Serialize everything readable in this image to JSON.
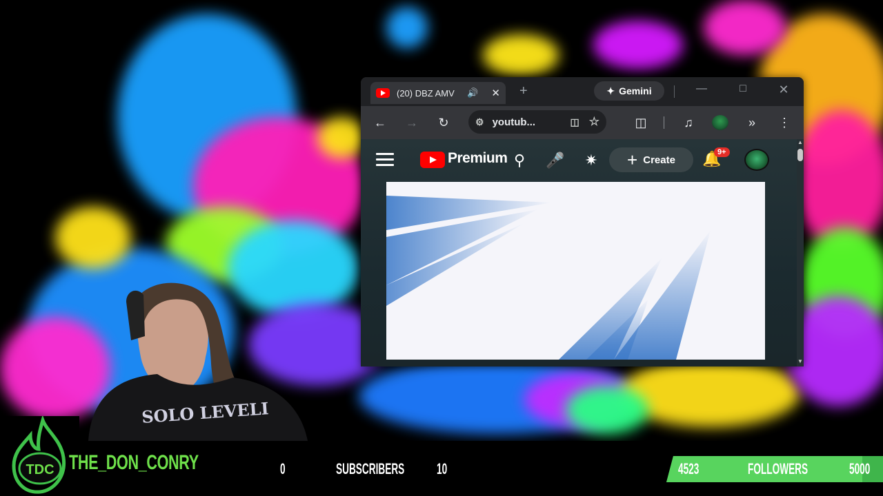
{
  "browser": {
    "tab_title": "(20) DBZ AMV",
    "gemini_label": "Gemini",
    "address": "youtub...",
    "colors": {
      "titlebar": "#202124",
      "toolbar": "#35363a"
    }
  },
  "youtube": {
    "brand_label": "Premium",
    "create_label": "Create",
    "notification_count": "9+"
  },
  "stream_overlay": {
    "channel_name": "THE_DON_CONRY",
    "subscribers": {
      "current": "0",
      "label": "SUBSCRIBERS",
      "goal": "10"
    },
    "followers": {
      "current": "4523",
      "label": "FOLLOWERS",
      "goal": "5000",
      "progress_fraction": 0.9046
    },
    "accent_color": "#6ee04a"
  }
}
